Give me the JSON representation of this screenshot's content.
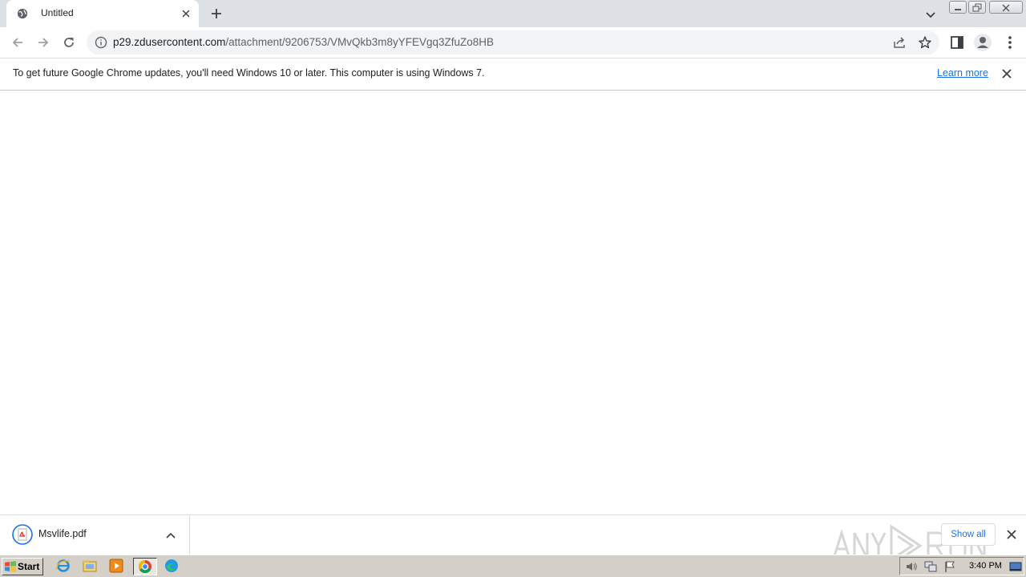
{
  "tab": {
    "title": "Untitled",
    "favicon": "globe-icon"
  },
  "address_bar": {
    "host": "p29.zdusercontent.com",
    "path": "/attachment/9206753/VMvQkb3m8yYFEVgq3ZfuZo8HB"
  },
  "infobar": {
    "message": "To get future Google Chrome updates, you'll need Windows 10 or later. This computer is using Windows 7.",
    "link_label": "Learn more"
  },
  "downloads": {
    "items": [
      {
        "filename": "Msvlife.pdf",
        "icon": "pdf-file-icon"
      }
    ],
    "show_all_label": "Show all"
  },
  "watermark": {
    "text": "ANY RUN"
  },
  "taskbar": {
    "start_label": "Start",
    "apps": [
      "internet-explorer-icon",
      "file-explorer-icon",
      "media-player-icon",
      "chrome-icon",
      "edge-icon"
    ],
    "clock": "3:40 PM"
  },
  "colors": {
    "accent": "#1a73e8",
    "tabstrip": "#dee1e6",
    "taskbar": "#d4d0c8"
  }
}
